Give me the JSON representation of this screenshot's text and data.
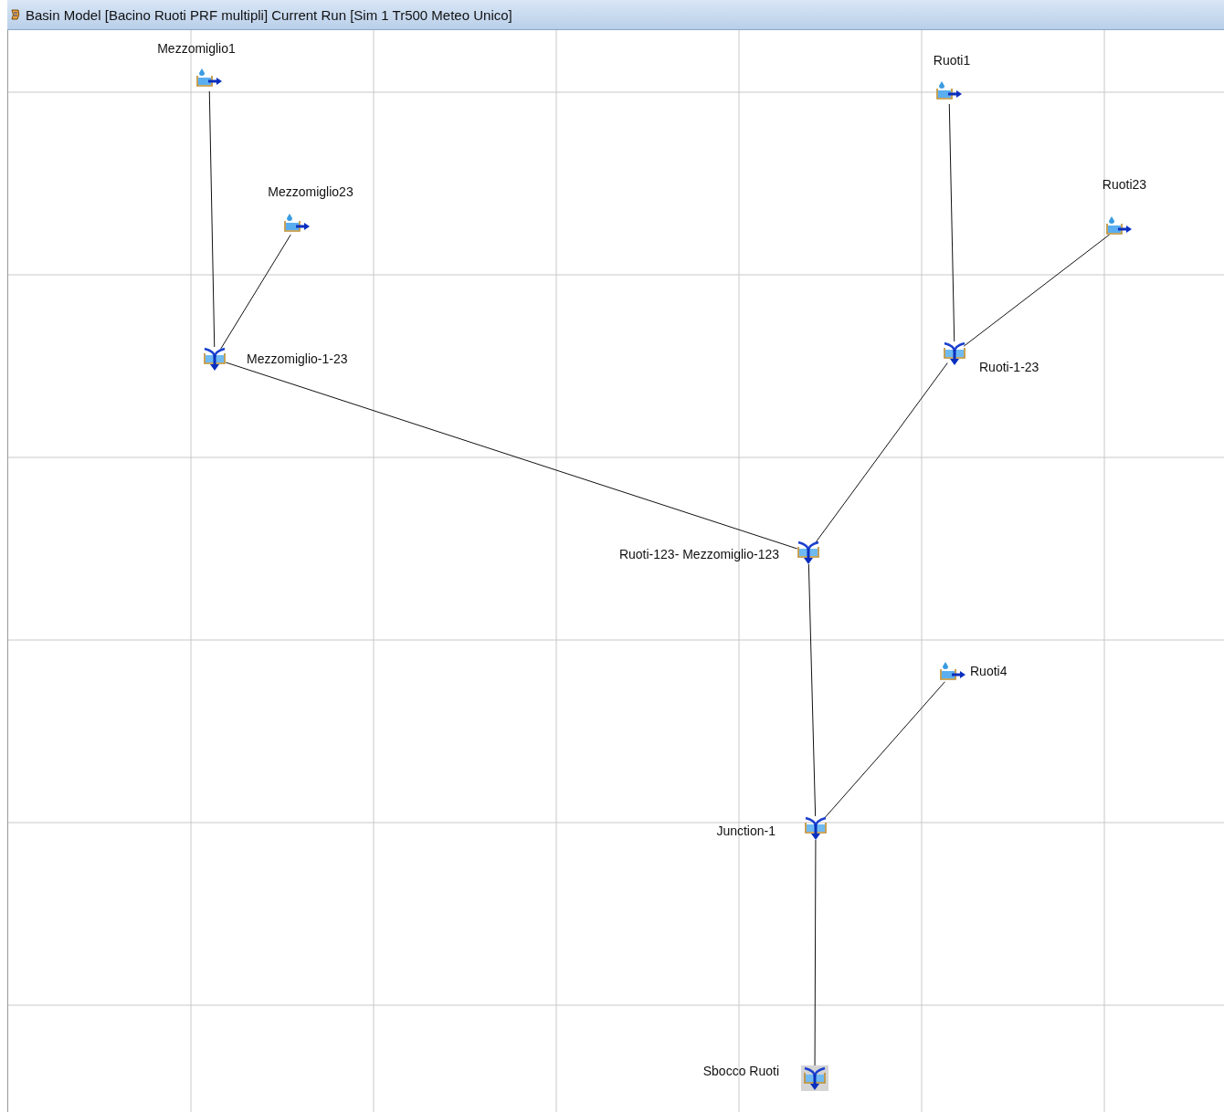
{
  "window": {
    "title": "Basin Model [Bacino Ruoti PRF multipli] Current Run [Sim 1 Tr500 Meteo Unico]"
  },
  "network": {
    "kind": "sink",
    "label": "Sbocco Ruoti",
    "children": [
      {
        "kind": "junction",
        "label": "Junction-1",
        "children": [
          {
            "kind": "junction",
            "label": "Ruoti-123- Mezzomiglio-123",
            "children": [
              {
                "kind": "junction",
                "label": "Mezzomiglio-1-23",
                "children": [
                  {
                    "kind": "subbasin",
                    "label": "Mezzomiglio1"
                  },
                  {
                    "kind": "subbasin",
                    "label": "Mezzomiglio23"
                  }
                ]
              },
              {
                "kind": "junction",
                "label": "Ruoti-1-23",
                "children": [
                  {
                    "kind": "subbasin",
                    "label": "Ruoti1"
                  },
                  {
                    "kind": "subbasin",
                    "label": "Ruoti23"
                  }
                ]
              }
            ]
          },
          {
            "kind": "subbasin",
            "label": "Ruoti4"
          }
        ]
      }
    ]
  }
}
